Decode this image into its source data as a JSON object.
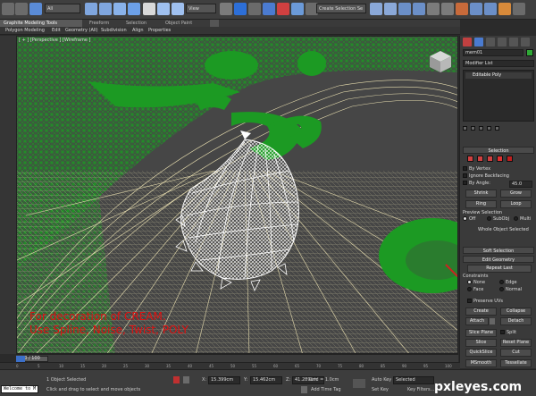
{
  "toolbar": {
    "selection_filter": "All",
    "reference_coord": "View",
    "named_selection_placeholder": "Create Selection Se"
  },
  "ribbon": {
    "tabs": [
      "Graphite Modeling Tools",
      "Freeform",
      "Selection",
      "Object Paint"
    ],
    "menu": [
      "Polygon Modeling",
      "Edit",
      "Geometry (All)",
      "Subdivision",
      "Align",
      "Properties"
    ]
  },
  "viewport": {
    "label": "[ + ] [Perspective ] [Wireframe ]",
    "caption_line1": "For decoration of CREAM.",
    "caption_line2": "Use Spline, Noise, Twist, POLY"
  },
  "command_panel": {
    "object_name": "mem01",
    "object_color": "#2fa836",
    "modifier_list": "Modifier List",
    "stack_item": "Editable Poly",
    "selection": {
      "title": "Selection",
      "by_vertex": "By Vertex",
      "ignore_backfacing": "Ignore Backfacing",
      "by_angle": "By Angle:",
      "by_angle_value": "45.0",
      "shrink": "Shrink",
      "grow": "Grow",
      "ring": "Ring",
      "loop": "Loop",
      "preview_selection": "Preview Selection",
      "preview_off": "Off",
      "preview_subobj": "SubObj",
      "preview_multi": "Multi",
      "status": "Whole Object Selected"
    },
    "soft_selection": "Soft Selection",
    "edit_geometry": {
      "title": "Edit Geometry",
      "repeat_last": "Repeat Last",
      "constraints": "Constraints",
      "none": "None",
      "edge": "Edge",
      "face": "Face",
      "normal": "Normal",
      "preserve_uvs": "Preserve UVs",
      "create": "Create",
      "collapse": "Collapse",
      "attach": "Attach",
      "detach": "Detach",
      "slice_plane": "Slice Plane",
      "split": "Split",
      "slice": "Slice",
      "reset_plane": "Reset Plane",
      "quickslice": "QuickSlice",
      "cut": "Cut",
      "msmooth": "MSmooth",
      "tessellate": "Tessellate"
    }
  },
  "timeline": {
    "frame": "0 / 100",
    "ticks": [
      "0",
      "5",
      "10",
      "15",
      "20",
      "25",
      "30",
      "35",
      "40",
      "45",
      "50",
      "55",
      "60",
      "65",
      "70",
      "75",
      "80",
      "85",
      "90",
      "95",
      "100"
    ]
  },
  "status": {
    "listener": "Welcome to M",
    "objects_selected": "1 Object Selected",
    "prompt": "Click and drag to select and move objects",
    "x_label": "X:",
    "x_value": "15.399cm",
    "y_label": "Y:",
    "y_value": "15.462cm",
    "z_label": "Z:",
    "z_value": "41.289cm",
    "grid": "Grid = 1.0cm",
    "add_time_tag": "Add Time Tag",
    "auto_key": "Auto Key",
    "set_key": "Set Key",
    "key_mode": "Selected",
    "key_filters": "Key Filters..."
  },
  "watermark": "pxleyes.com",
  "colors": {
    "mesh_green": "#1c9a23",
    "mesh_white": "#ffffff",
    "spline_cream": "#e9dfb0",
    "caption_red": "#e01010",
    "accent_blue": "#2d6fd8"
  }
}
